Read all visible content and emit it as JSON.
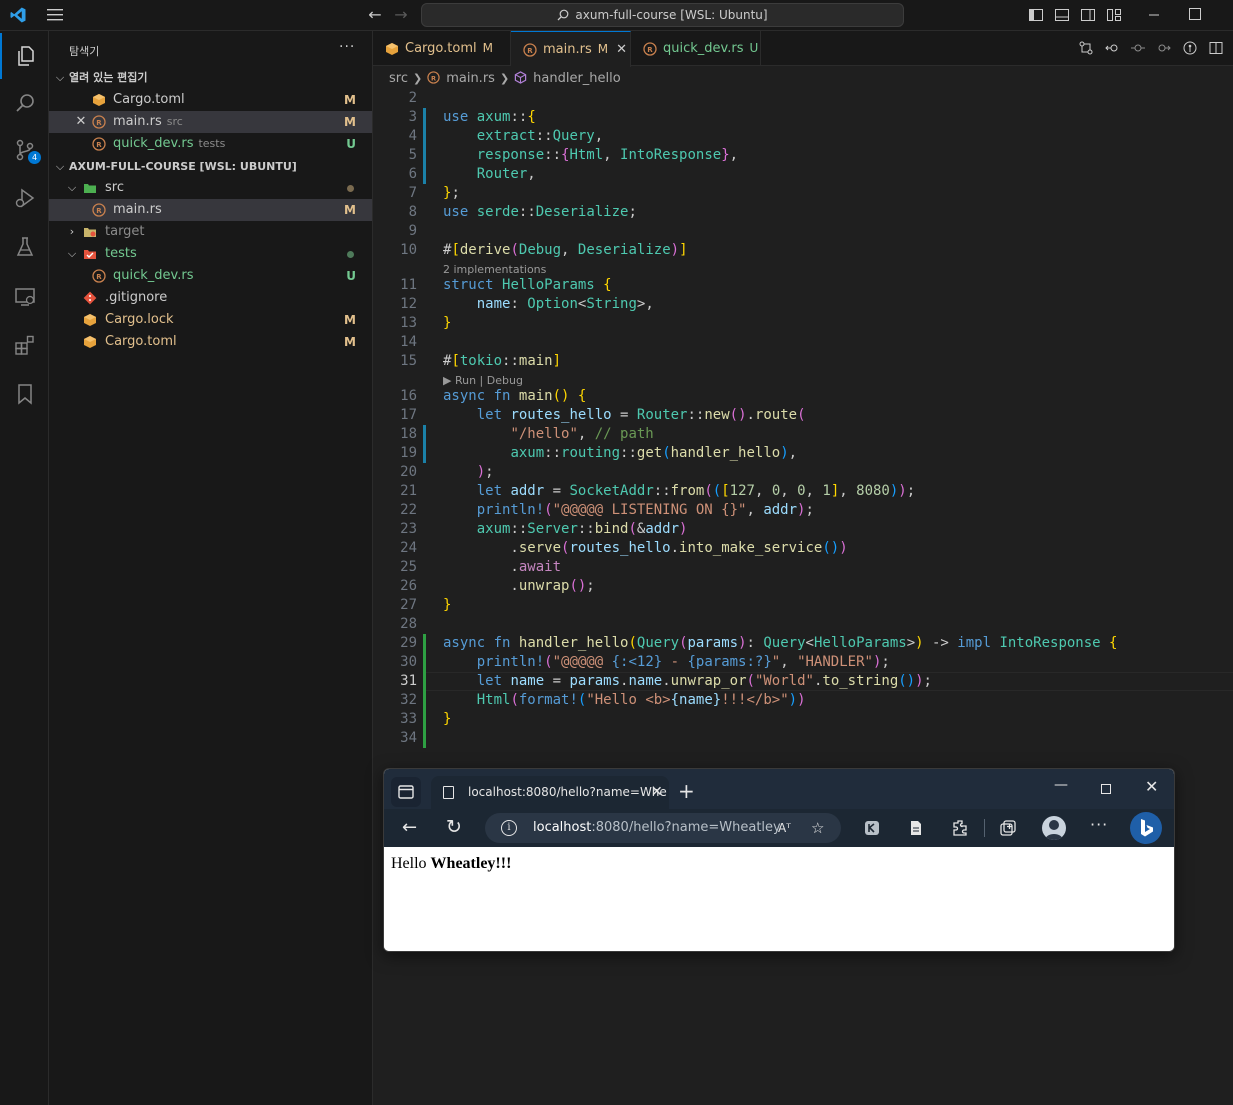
{
  "titlebar": {
    "command_center": "axum-full-course [WSL: Ubuntu]"
  },
  "activity": {
    "scm_badge": "4"
  },
  "sidebar": {
    "title": "탐색기",
    "open_editors_header": "열려 있는 편집기",
    "open_editors": [
      {
        "name": "Cargo.toml",
        "desc": "",
        "status": "M"
      },
      {
        "name": "main.rs",
        "desc": "src",
        "status": "M"
      },
      {
        "name": "quick_dev.rs",
        "desc": "tests",
        "status": "U"
      }
    ],
    "workspace_header": "AXUM-FULL-COURSE [WSL: UBUNTU]",
    "tree": [
      {
        "name": "src",
        "status": ""
      },
      {
        "name": "main.rs",
        "status": "M"
      },
      {
        "name": "target",
        "status": ""
      },
      {
        "name": "tests",
        "status": ""
      },
      {
        "name": "quick_dev.rs",
        "status": "U"
      },
      {
        "name": ".gitignore",
        "status": ""
      },
      {
        "name": "Cargo.lock",
        "status": "M"
      },
      {
        "name": "Cargo.toml",
        "status": "M"
      }
    ]
  },
  "tabs": [
    {
      "label": "Cargo.toml",
      "mark": "M"
    },
    {
      "label": "main.rs",
      "mark": "M"
    },
    {
      "label": "quick_dev.rs",
      "mark": "U"
    }
  ],
  "breadcrumb": {
    "folder": "src",
    "file": "main.rs",
    "symbol": "handler_hello"
  },
  "editor": {
    "line_numbers": [
      "2",
      "3",
      "4",
      "5",
      "6",
      "7",
      "8",
      "9",
      "10",
      "11",
      "12",
      "13",
      "14",
      "15",
      "16",
      "17",
      "18",
      "19",
      "20",
      "21",
      "22",
      "23",
      "24",
      "25",
      "26",
      "27",
      "28",
      "29",
      "30",
      "31",
      "32",
      "33",
      "34"
    ],
    "code_lens": {
      "implementations": "2 implementations",
      "run_debug": "▶ Run | Debug"
    },
    "code": {
      "l3_kw": "use",
      "l3_mod": "axum",
      "l4_a": "extract",
      "l4_b": "Query",
      "l5_a": "response",
      "l5_b": "Html",
      "l5_c": "IntoResponse",
      "l6_a": "Router",
      "l8_kw": "use",
      "l8_mod": "serde",
      "l8_b": "Deserialize",
      "l10_a": "derive",
      "l10_b": "Debug",
      "l10_c": "Deserialize",
      "l11_kw": "struct",
      "l11_ty": "HelloParams",
      "l12_a": "name",
      "l12_b": "Option",
      "l12_c": "String",
      "l15_a": "tokio",
      "l15_b": "main",
      "l16_kw1": "async",
      "l16_kw2": "fn",
      "l16_fn": "main",
      "l17_kw": "let",
      "l17_var": "routes_hello",
      "l17_ty": "Router",
      "l17_fn1": "new",
      "l17_fn2": "route",
      "l18_str": "\"/hello\"",
      "l18_cmt": "// path",
      "l19_a": "axum",
      "l19_b": "routing",
      "l19_fn": "get",
      "l19_arg": "handler_hello",
      "l21_kw": "let",
      "l21_var": "addr",
      "l21_ty": "SocketAddr",
      "l21_fn": "from",
      "l21_n1": "127",
      "l21_n2": "0",
      "l21_n3": "0",
      "l21_n4": "1",
      "l21_n5": "8080",
      "l22_mac": "println!",
      "l22_str": "\"@@@@@ LISTENING ON {}\"",
      "l22_var": "addr",
      "l23_a": "axum",
      "l23_ty": "Server",
      "l23_fn": "bind",
      "l23_var": "addr",
      "l24_fn1": "serve",
      "l24_var": "routes_hello",
      "l24_fn2": "into_make_service",
      "l25_kw": "await",
      "l26_fn": "unwrap",
      "l29_kw1": "async",
      "l29_kw2": "fn",
      "l29_fn": "handler_hello",
      "l29_ty1": "Query",
      "l29_var": "params",
      "l29_ty2": "Query",
      "l29_ty3": "HelloParams",
      "l29_kw3": "impl",
      "l29_ty4": "IntoResponse",
      "l30_mac": "println!",
      "l30_str1": "\"@@@@@ ",
      "l30_fmt1": "{:<12}",
      "l30_str2": " - ",
      "l30_fmt2": "{params:?}",
      "l30_str3": "\"",
      "l30_str4": "\"HANDLER\"",
      "l31_kw": "let",
      "l31_var": "name",
      "l31_v2": "params",
      "l31_v3": "name",
      "l31_fn1": "unwrap_or",
      "l31_str": "\"World\"",
      "l31_fn2": "to_string",
      "l32_ty": "Html",
      "l32_mac": "format!",
      "l32_str1": "\"Hello <b>",
      "l32_fmt": "{name}",
      "l32_str2": "!!!</b>\""
    }
  },
  "browser": {
    "tab_title": "localhost:8080/hello?name=Whe",
    "url_host": "localhost",
    "url_rest": ":8080/hello?name=Wheatley",
    "read_aloud": "Aᵀ",
    "page_text_normal": "Hello ",
    "page_text_bold": "Wheatley!!!"
  }
}
